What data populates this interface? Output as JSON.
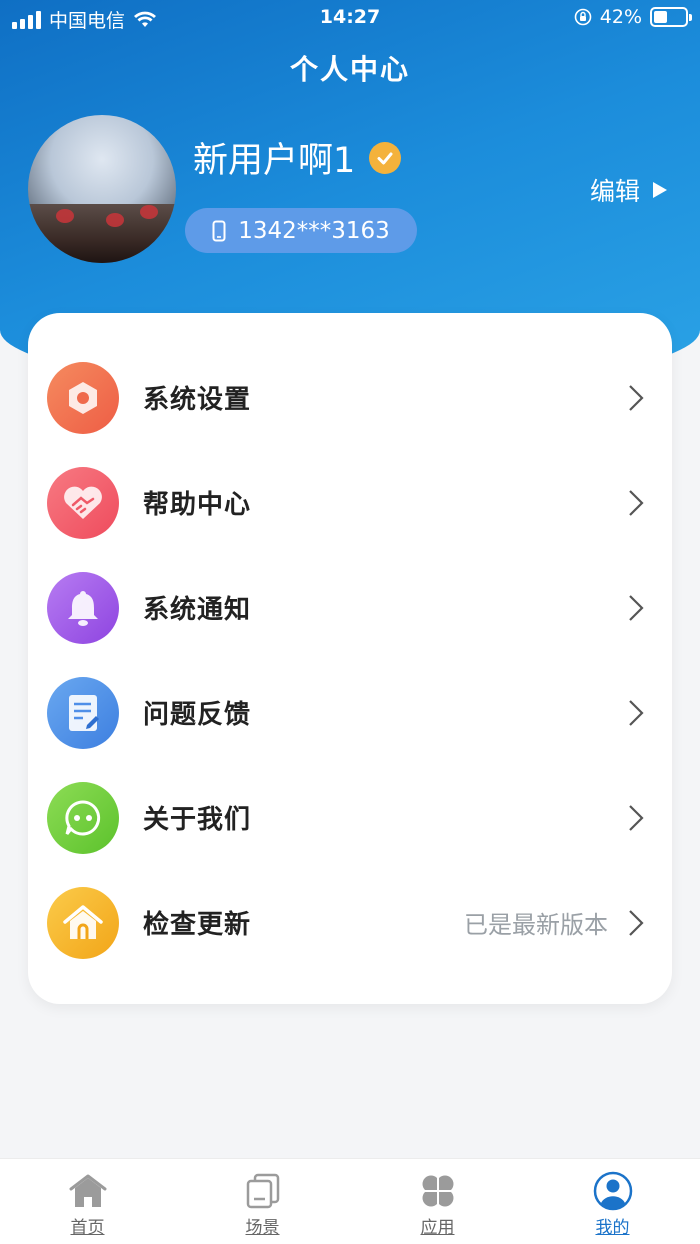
{
  "status_bar": {
    "carrier": "中国电信",
    "time": "14:27",
    "battery_percent": "42%",
    "battery_level": 0.42
  },
  "page": {
    "title": "个人中心"
  },
  "profile": {
    "name": "新用户啊1",
    "phone": "1342***3163",
    "edit_label": "编辑"
  },
  "menu": {
    "items": [
      {
        "label": "系统设置",
        "icon": "settings-icon",
        "color": "#f0744e"
      },
      {
        "label": "帮助中心",
        "icon": "handshake-icon",
        "color": "#f35d6b"
      },
      {
        "label": "系统通知",
        "icon": "bell-icon",
        "color": "#a35ee8"
      },
      {
        "label": "问题反馈",
        "icon": "feedback-icon",
        "color": "#4f8fe8"
      },
      {
        "label": "关于我们",
        "icon": "chat-icon",
        "color": "#72cf3c"
      },
      {
        "label": "检查更新",
        "icon": "home-icon",
        "color": "#f4b523",
        "extra": "已是最新版本"
      }
    ]
  },
  "tabbar": {
    "tabs": [
      {
        "label": "首页",
        "icon": "home-tab-icon"
      },
      {
        "label": "场景",
        "icon": "scene-tab-icon"
      },
      {
        "label": "应用",
        "icon": "apps-tab-icon"
      },
      {
        "label": "我的",
        "icon": "profile-tab-icon",
        "active": true
      }
    ]
  },
  "colors": {
    "header_start": "#0f6fc4",
    "header_end": "#2ba3e6",
    "active_tab": "#1b73c9"
  }
}
